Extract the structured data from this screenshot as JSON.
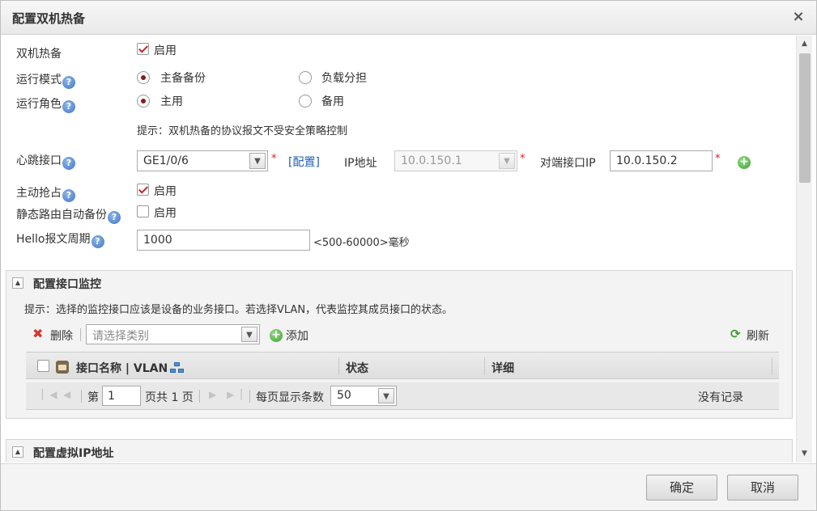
{
  "dialog": {
    "title": "配置双机热备",
    "close": "×"
  },
  "form": {
    "ha": {
      "label": "双机热备",
      "enable_label": "启用",
      "checked": true
    },
    "run_mode": {
      "label": "运行模式",
      "options": [
        "主备备份",
        "负载分担"
      ],
      "selected": "主备备份"
    },
    "run_role": {
      "label": "运行角色",
      "options": [
        "主用",
        "备用"
      ],
      "selected": "主用"
    },
    "hint": "提示：双机热备的协议报文不受安全策略控制",
    "heartbeat": {
      "label": "心跳接口",
      "interface": "GE1/0/6",
      "required": "*",
      "config_link": "[配置]",
      "ip_label": "IP地址",
      "ip_value": "10.0.150.1",
      "peer_label": "对端接口IP",
      "peer_value": "10.0.150.2"
    },
    "preempt": {
      "label": "主动抢占",
      "enable_label": "启用",
      "checked": true
    },
    "static_route": {
      "label": "静态路由自动备份",
      "enable_label": "启用",
      "checked": false
    },
    "hello": {
      "label": "Hello报文周期",
      "value": "1000",
      "range": "<500-60000>毫秒"
    }
  },
  "monitor_panel": {
    "title": "配置接口监控",
    "hint": "提示：选择的监控接口应该是设备的业务接口。若选择VLAN，代表监控其成员接口的状态。",
    "toolbar": {
      "delete": "删除",
      "category_placeholder": "请选择类别",
      "add": "添加",
      "refresh": "刷新"
    },
    "columns": [
      "接口名称 | VLAN",
      "状态",
      "详细"
    ],
    "pager": {
      "page_prefix": "第",
      "page": "1",
      "page_suffix": "页共 1 页",
      "per_page_label": "每页显示条数",
      "per_page": "50",
      "empty": "没有记录"
    }
  },
  "vip_panel": {
    "title": "配置虚拟IP地址"
  },
  "footer": {
    "ok": "确定",
    "cancel": "取消"
  },
  "colors": {
    "accent_red": "#c0262d",
    "link_blue": "#1f5fb5",
    "add_green": "#3a9d2f"
  }
}
